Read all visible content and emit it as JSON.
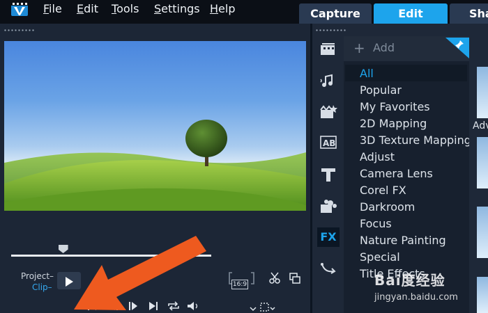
{
  "menu": {
    "items": [
      {
        "label": "File",
        "mnemonic": "F",
        "rest": "ile"
      },
      {
        "label": "Edit",
        "mnemonic": "E",
        "rest": "dit"
      },
      {
        "label": "Tools",
        "mnemonic": "T",
        "rest": "ools"
      },
      {
        "label": "Settings",
        "mnemonic": "S",
        "rest": "ettings"
      },
      {
        "label": "Help",
        "mnemonic": "H",
        "rest": "elp"
      }
    ]
  },
  "tabs": {
    "capture": "Capture",
    "edit": "Edit",
    "share": "Sha"
  },
  "player": {
    "mode_project": "Project–",
    "mode_clip": "Clip–",
    "aspect": "16:9",
    "scrub_position": 0.26
  },
  "library": {
    "add_label": "Add",
    "categories": [
      "All",
      "Popular",
      "My Favorites",
      "2D Mapping",
      "3D Texture Mapping",
      "Adjust",
      "Camera Lens",
      "Corel FX",
      "Darkroom",
      "Focus",
      "Nature Painting",
      "Special",
      "Title Effects"
    ],
    "selected_category": "All",
    "rail_fx_label": "FX",
    "thumb_label": "Adv"
  },
  "watermark": {
    "text": "Bai度经验",
    "url": "jingyan.baidu.com"
  },
  "colors": {
    "accent": "#1da4ec",
    "annotation_arrow": "#ee5a1f"
  }
}
